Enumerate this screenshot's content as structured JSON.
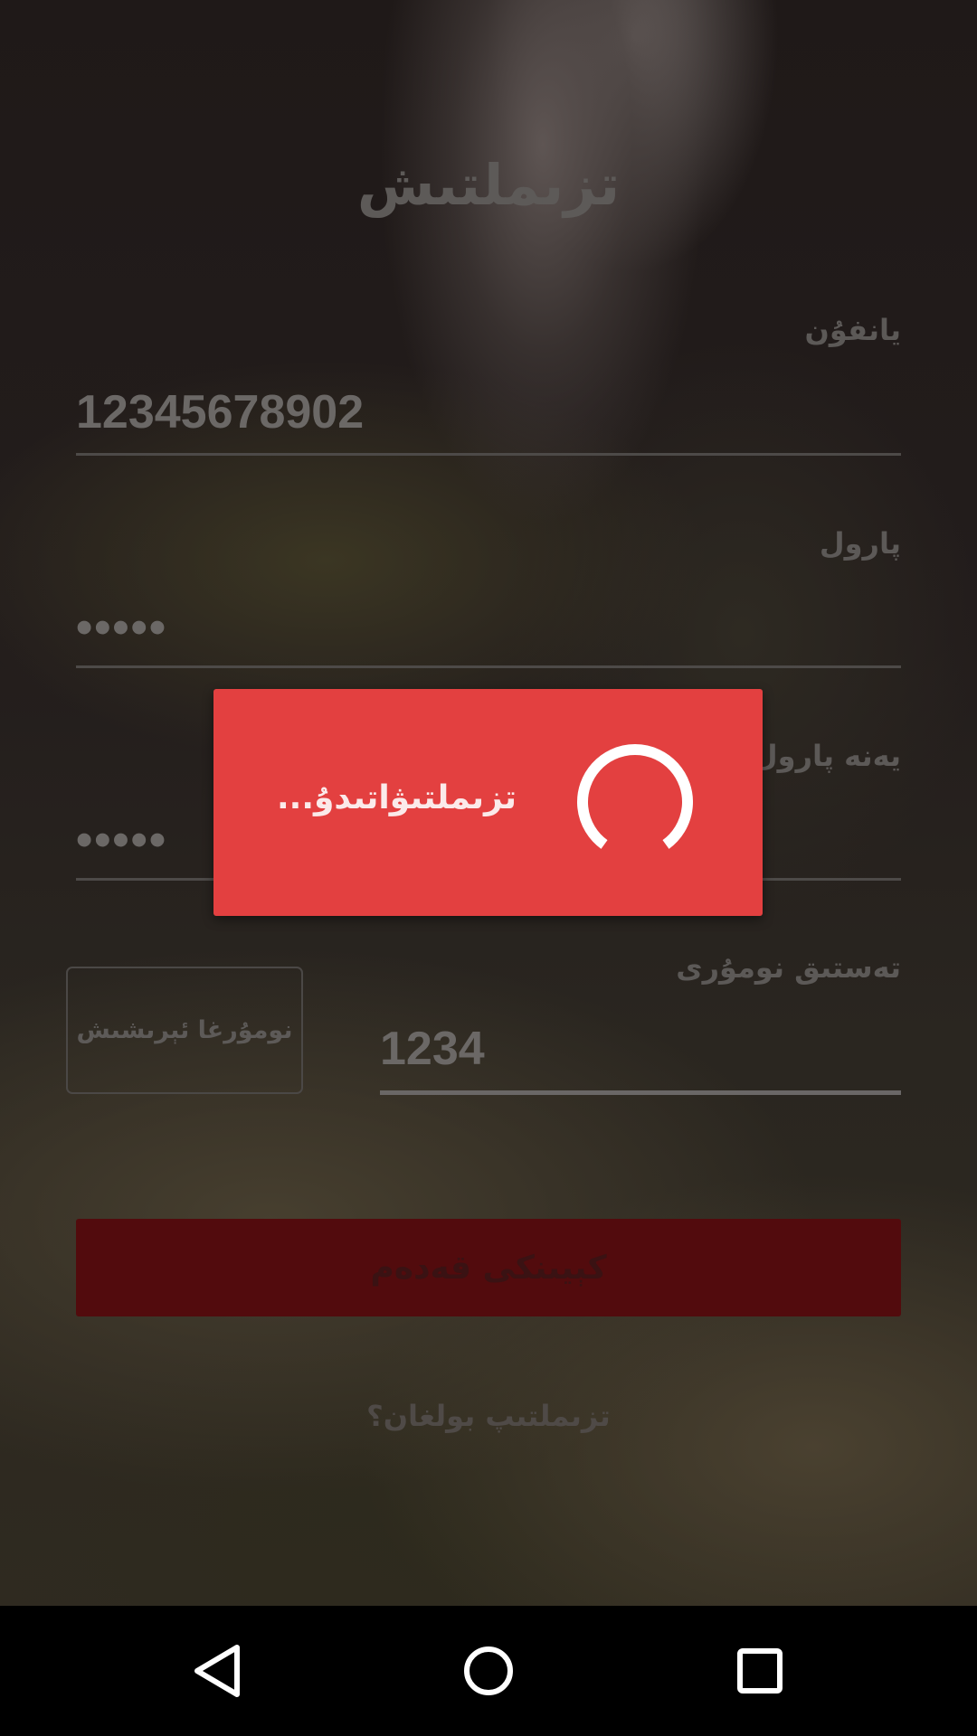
{
  "title": "تزىملتىش",
  "form": {
    "phone_label": "يانفوُن",
    "phone_value": "12345678902",
    "password_label": "پارول",
    "password_value": "•••••",
    "confirm_label": "يەنە پارول",
    "confirm_value": "•••••",
    "code_label": "تەستىق نومۇرى",
    "code_value": "1234",
    "get_code_button": "نومۇرغا ئېرىشىش",
    "submit_button": "كېيىنكى قەدەم",
    "register_link": "تزىملتىپ بولغان؟"
  },
  "dialog": {
    "message": "تزىملتىۋاتىدۇ..."
  },
  "navbar": {
    "back_icon": "back-triangle-icon",
    "home_icon": "home-circle-icon",
    "recents_icon": "recents-square-icon"
  },
  "colors": {
    "dialog_bg": "#e34040",
    "submit_bg": "#520b0d",
    "navbar_bg": "#000000"
  }
}
